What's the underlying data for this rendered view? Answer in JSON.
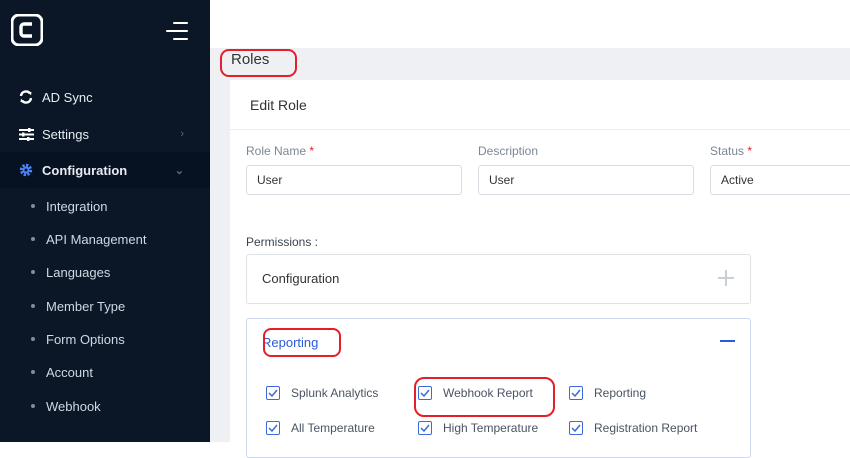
{
  "colors": {
    "sidebar_bg": "#0b1726",
    "accent": "#2d5bd6",
    "annotation": "#e3202a"
  },
  "sidebar": {
    "logo_letter": "C",
    "items": [
      {
        "label": "AD Sync",
        "icon": "sync-icon"
      },
      {
        "label": "Settings",
        "icon": "sliders-icon"
      },
      {
        "label": "Configuration",
        "icon": "gear-icon",
        "active": true
      }
    ],
    "sub_items": [
      {
        "label": "Integration"
      },
      {
        "label": "API Management"
      },
      {
        "label": "Languages"
      },
      {
        "label": "Member Type"
      },
      {
        "label": "Form Options"
      },
      {
        "label": "Account"
      },
      {
        "label": "Webhook"
      }
    ]
  },
  "page": {
    "title": "Roles"
  },
  "form": {
    "title": "Edit Role",
    "role_name": {
      "label": "Role Name",
      "required": "*",
      "value": "User"
    },
    "description": {
      "label": "Description",
      "value": "User"
    },
    "status": {
      "label": "Status",
      "required": "*",
      "value": "Active"
    },
    "permissions_label": "Permissions :",
    "sections": [
      {
        "title": "Configuration",
        "expanded": false
      },
      {
        "title": "Reporting",
        "expanded": true,
        "checkboxes": [
          {
            "label": "Splunk Analytics",
            "checked": true
          },
          {
            "label": "Webhook Report",
            "checked": true
          },
          {
            "label": "Reporting",
            "checked": true
          },
          {
            "label": "All Temperature",
            "checked": true
          },
          {
            "label": "High Temperature",
            "checked": true
          },
          {
            "label": "Registration Report",
            "checked": true
          }
        ]
      }
    ]
  }
}
